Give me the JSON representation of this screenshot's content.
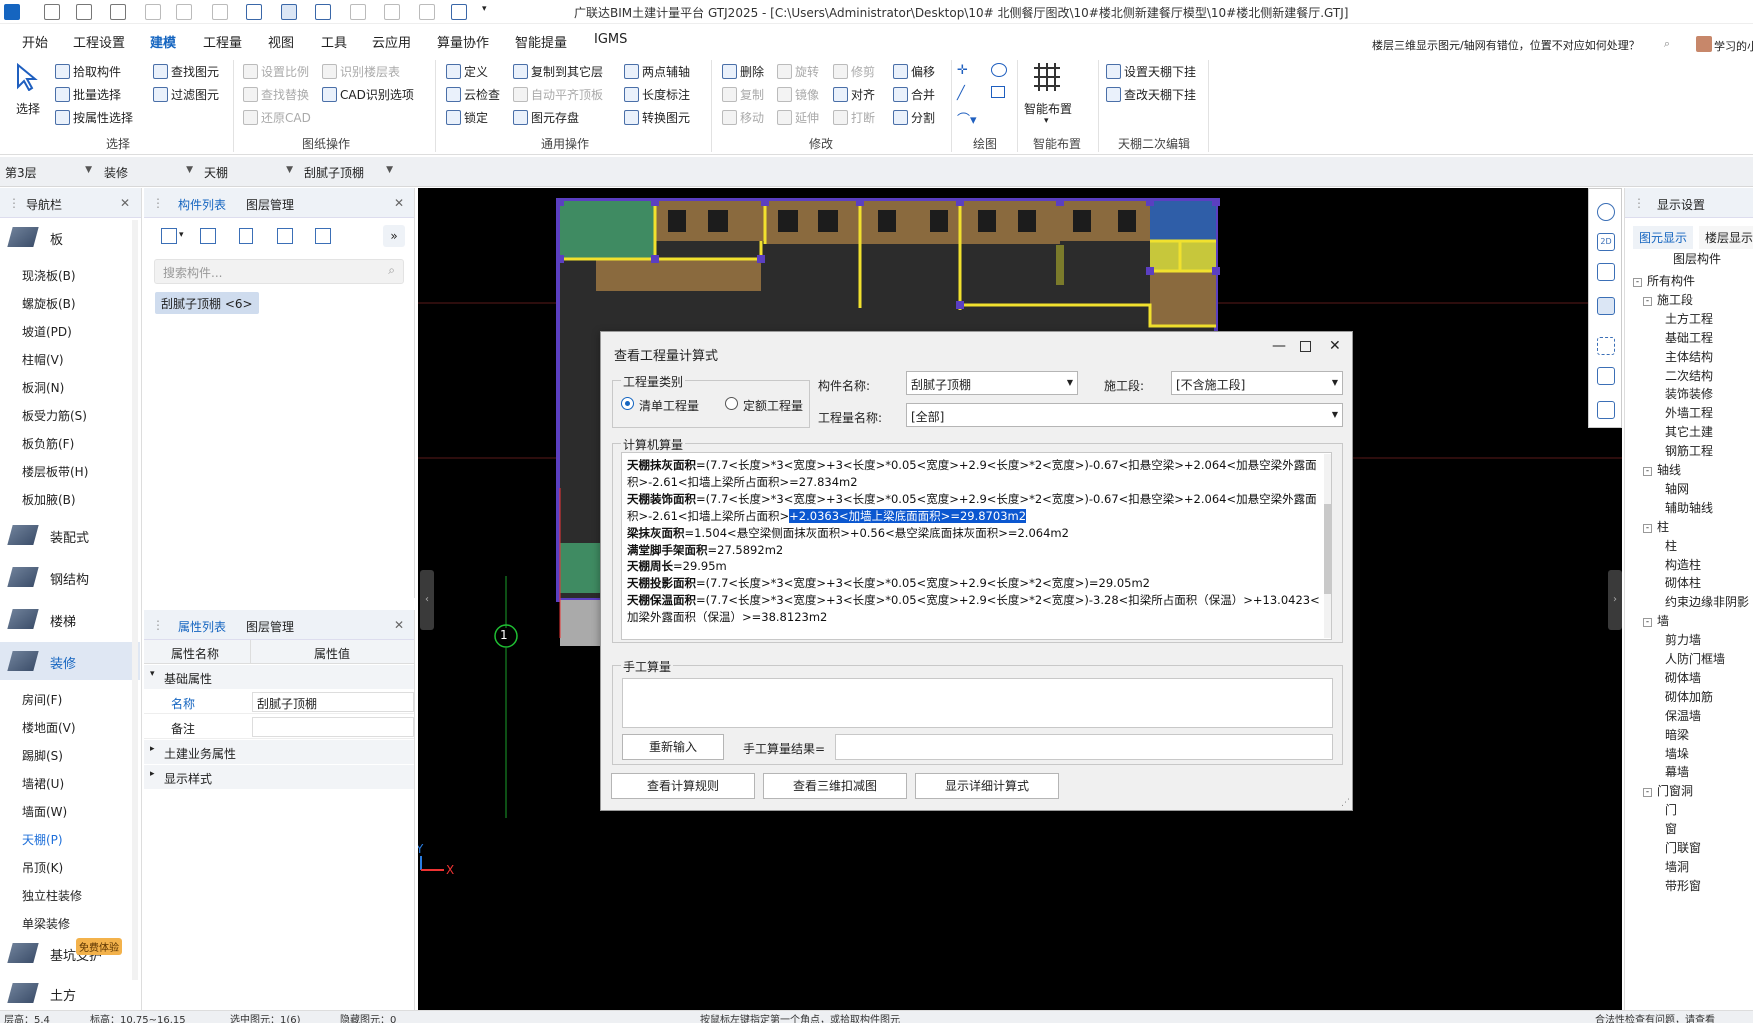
{
  "app": {
    "title": "广联达BIM土建计量平台 GTJ2025 - [C:\\Users\\Administrator\\Desktop\\10# 北侧餐厅图改\\10#楼北侧新建餐厅模型\\10#楼北侧新建餐厅.GTJ]"
  },
  "menu": {
    "items": [
      "开始",
      "工程设置",
      "建模",
      "工程量",
      "视图",
      "工具",
      "云应用",
      "算量协作",
      "智能提量",
      "IGMS"
    ],
    "active": "建模",
    "help_search": "楼层三维显示图元/轴网有错位，位置不对应如何处理？",
    "user_label": "学习的小"
  },
  "ribbon": {
    "select_group": {
      "select": "选择",
      "pick": "拾取构件",
      "batch": "批量选择",
      "by_attr": "按属性选择",
      "find": "查找图元",
      "filter": "过滤图元",
      "label": "选择"
    },
    "drawing_ops": {
      "set_ratio": "设置比例",
      "recognize_layer": "识别楼层表",
      "find_replace": "查找替换",
      "cad_options": "CAD识别选项",
      "restore_cad": "还原CAD",
      "label": "图纸操作"
    },
    "common_ops": {
      "define": "定义",
      "copy_to_floor": "复制到其它层",
      "two_point_axis": "两点辅轴",
      "cloud_check": "云检查",
      "auto_flat_top": "自动平齐顶板",
      "length_dim": "长度标注",
      "lock": "锁定",
      "save_element": "图元存盘",
      "convert_element": "转换图元",
      "label": "通用操作"
    },
    "modify": {
      "delete": "删除",
      "rotate": "旋转",
      "trim": "修剪",
      "offset": "偏移",
      "copy": "复制",
      "mirror": "镜像",
      "align": "对齐",
      "merge": "合并",
      "move": "移动",
      "extend": "延伸",
      "break": "打断",
      "split": "分割",
      "label": "修改"
    },
    "draw_label": "绘图",
    "smart_layout": {
      "button": "智能布置",
      "label": "智能布置"
    },
    "ceiling_edit": {
      "set_drop": "设置天棚下挂",
      "check_drop": "查改天棚下挂",
      "label": "天棚二次编辑"
    }
  },
  "filterbar": {
    "floor": "第3层",
    "type": "装修",
    "category": "天棚",
    "component": "刮腻子顶棚"
  },
  "nav": {
    "title": "导航栏",
    "categories": [
      {
        "label": "板"
      },
      {
        "label": "装配式"
      },
      {
        "label": "钢结构"
      },
      {
        "label": "楼梯"
      },
      {
        "label": "装修"
      },
      {
        "label": "基坑支护"
      },
      {
        "label": "土方"
      }
    ],
    "slab_items": [
      "现浇板(B)",
      "螺旋板(B)",
      "坡道(PD)",
      "柱帽(V)",
      "板洞(N)",
      "板受力筋(S)",
      "板负筋(F)",
      "楼层板带(H)",
      "板加腋(B)"
    ],
    "decor_items": [
      "房间(F)",
      "楼地面(V)",
      "踢脚(S)",
      "墙裙(U)",
      "墙面(W)",
      "天棚(P)",
      "吊顶(K)",
      "独立柱装修",
      "单梁装修"
    ],
    "selected_item": "天棚(P)",
    "badge": "免费体验"
  },
  "component_list": {
    "tabs": [
      "构件列表",
      "图层管理"
    ],
    "search_placeholder": "搜索构件...",
    "item": "刮腻子顶棚 <6>"
  },
  "property_list": {
    "tabs": [
      "属性列表",
      "图层管理"
    ],
    "col_name": "属性名称",
    "col_value": "属性值",
    "group_basic": "基础属性",
    "rows": [
      {
        "name": "名称",
        "value": "刮腻子顶棚"
      },
      {
        "name": "备注",
        "value": ""
      }
    ],
    "group_civil": "土建业务属性",
    "group_display": "显示样式"
  },
  "viewport": {
    "axis_label": "1",
    "axis_x": "X",
    "axis_y": "Y"
  },
  "dialog": {
    "title": "查看工程量计算式",
    "qty_type_label": "工程量类别",
    "radio_list": "清单工程量",
    "radio_quota": "定额工程量",
    "component_name_label": "构件名称:",
    "component_name": "刮腻子顶棚",
    "stage_label": "施工段:",
    "stage": "[不含施工段]",
    "qty_name_label": "工程量名称:",
    "qty_name": "[全部]",
    "machine_calc_label": "计算机算量",
    "lines": [
      {
        "name": "天棚抹灰面积",
        "expr": "=(7.7<长度>*3<宽度>+3<长度>*0.05<宽度>+2.9<长度>*2<宽度>)-0.67<扣悬空梁>+2.064<加悬空梁外露面积>-2.61<扣墙上梁所占面积>=27.834m2",
        "hl": ""
      },
      {
        "name": "天棚装饰面积",
        "expr": "=(7.7<长度>*3<宽度>+3<长度>*0.05<宽度>+2.9<长度>*2<宽度>)-0.67<扣悬空梁>+2.064<加悬空梁外露面积>-2.61<扣墙上梁所占面积>",
        "hl": "+2.0363<加墙上梁底面面积>=29.8703m2"
      },
      {
        "name": "梁抹灰面积",
        "expr": "=1.504<悬空梁侧面抹灰面积>+0.56<悬空梁底面抹灰面积>=2.064m2",
        "hl": ""
      },
      {
        "name": "满堂脚手架面积",
        "expr": "=27.5892m2",
        "hl": ""
      },
      {
        "name": "天棚周长",
        "expr": "=29.95m",
        "hl": ""
      },
      {
        "name": "天棚投影面积",
        "expr": "=(7.7<长度>*3<宽度>+3<长度>*0.05<宽度>+2.9<长度>*2<宽度>)=29.05m2",
        "hl": ""
      },
      {
        "name": "天棚保温面积",
        "expr": "=(7.7<长度>*3<宽度>+3<长度>*0.05<宽度>+2.9<长度>*2<宽度>)-3.28<扣梁所占面积（保温）>+13.0423<加梁外露面积（保温）>=38.8123m2",
        "hl": ""
      }
    ],
    "manual_label": "手工算量",
    "reinput": "重新输入",
    "manual_result_label": "手工算量结果=",
    "btn_rules": "查看计算规则",
    "btn_3d": "查看三维扣减图",
    "btn_detail": "显示详细计算式"
  },
  "display_settings": {
    "title": "显示设置",
    "tabs": [
      "图元显示",
      "楼层显示"
    ],
    "header": "图层构件",
    "tree": [
      {
        "label": "所有构件",
        "level": 0,
        "box": "-"
      },
      {
        "label": "施工段",
        "level": 1,
        "box": "-"
      },
      {
        "label": "土方工程",
        "level": 2
      },
      {
        "label": "基础工程",
        "level": 2
      },
      {
        "label": "主体结构",
        "level": 2
      },
      {
        "label": "二次结构",
        "level": 2
      },
      {
        "label": "装饰装修",
        "level": 2
      },
      {
        "label": "外墙工程",
        "level": 2
      },
      {
        "label": "其它土建",
        "level": 2
      },
      {
        "label": "钢筋工程",
        "level": 2
      },
      {
        "label": "轴线",
        "level": 1,
        "box": "-"
      },
      {
        "label": "轴网",
        "level": 2
      },
      {
        "label": "辅助轴线",
        "level": 2
      },
      {
        "label": "柱",
        "level": 1,
        "box": "-"
      },
      {
        "label": "柱",
        "level": 2
      },
      {
        "label": "构造柱",
        "level": 2
      },
      {
        "label": "砌体柱",
        "level": 2
      },
      {
        "label": "约束边缘非阴影",
        "level": 2
      },
      {
        "label": "墙",
        "level": 1,
        "box": "-"
      },
      {
        "label": "剪力墙",
        "level": 2
      },
      {
        "label": "人防门框墙",
        "level": 2
      },
      {
        "label": "砌体墙",
        "level": 2
      },
      {
        "label": "砌体加筋",
        "level": 2
      },
      {
        "label": "保温墙",
        "level": 2
      },
      {
        "label": "暗梁",
        "level": 2
      },
      {
        "label": "墙垛",
        "level": 2
      },
      {
        "label": "幕墙",
        "level": 2
      },
      {
        "label": "门窗洞",
        "level": 1,
        "box": "-"
      },
      {
        "label": "门",
        "level": 2
      },
      {
        "label": "窗",
        "level": 2
      },
      {
        "label": "门联窗",
        "level": 2
      },
      {
        "label": "墙洞",
        "level": 2
      },
      {
        "label": "带形窗",
        "level": 2
      }
    ]
  },
  "statusbar": {
    "floor_height": "层高：5.4",
    "elevation": "标高：10.75~16.15",
    "selected": "选中图元：1(6)",
    "hidden": "隐藏图元：0",
    "hint": "按鼠标左键指定第一个角点，或拾取构件图元",
    "check": "合法性检查有问题，请查看"
  },
  "colors": {
    "accent": "#1565c0",
    "highlight": "#0b57d0",
    "viewport_bg": "#000000"
  }
}
